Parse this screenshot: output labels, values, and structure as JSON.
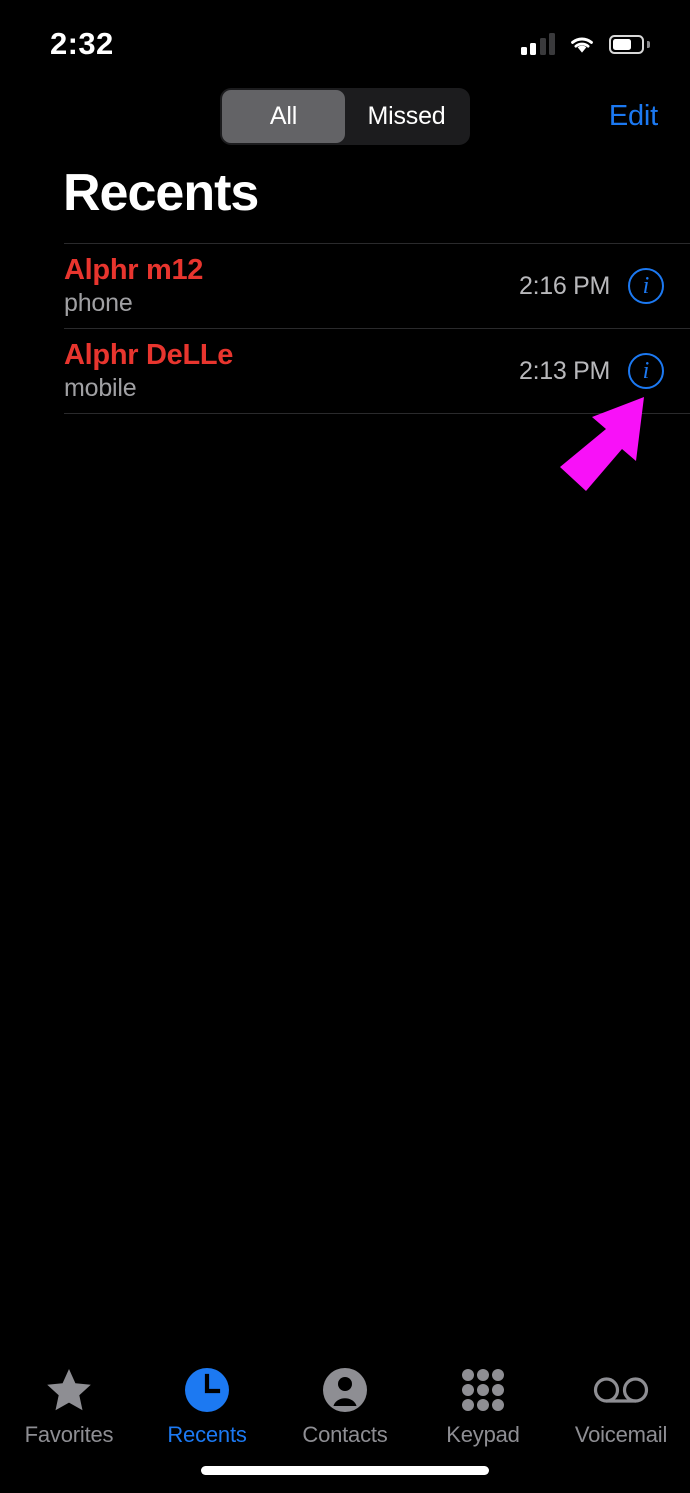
{
  "status_bar": {
    "time": "2:32",
    "signal_icon": "cellular-signal-icon",
    "signal_bars_filled": 2,
    "signal_bars_total": 4,
    "wifi_icon": "wifi-icon",
    "battery_icon": "battery-icon",
    "battery_percent": 66
  },
  "nav_bar": {
    "segments": [
      {
        "label": "All",
        "selected": true
      },
      {
        "label": "Missed",
        "selected": false
      }
    ],
    "edit_label": "Edit"
  },
  "page": {
    "title": "Recents"
  },
  "calls": [
    {
      "name": "Alphr m12",
      "label": "phone",
      "time": "2:16 PM",
      "missed": true,
      "info_glyph": "i"
    },
    {
      "name": "Alphr DeLLe",
      "label": "mobile",
      "time": "2:13 PM",
      "missed": true,
      "info_glyph": "i"
    }
  ],
  "annotation": {
    "type": "arrow",
    "color": "#F811F8",
    "points_to": "info-button-row-2"
  },
  "tab_bar": {
    "tabs": [
      {
        "label": "Favorites",
        "icon": "star-icon",
        "active": false
      },
      {
        "label": "Recents",
        "icon": "clock-icon",
        "active": true
      },
      {
        "label": "Contacts",
        "icon": "person-circle-icon",
        "active": false
      },
      {
        "label": "Keypad",
        "icon": "keypad-grid-icon",
        "active": false
      },
      {
        "label": "Voicemail",
        "icon": "voicemail-icon",
        "active": false
      }
    ]
  },
  "colors": {
    "background": "#000000",
    "accent_blue": "#1C79F2",
    "missed_red": "#E8352E",
    "secondary_text": "#A0A0A3",
    "segment_track": "#1C1C1E",
    "segment_selected": "#636366",
    "annotation_magenta": "#F811F8"
  }
}
